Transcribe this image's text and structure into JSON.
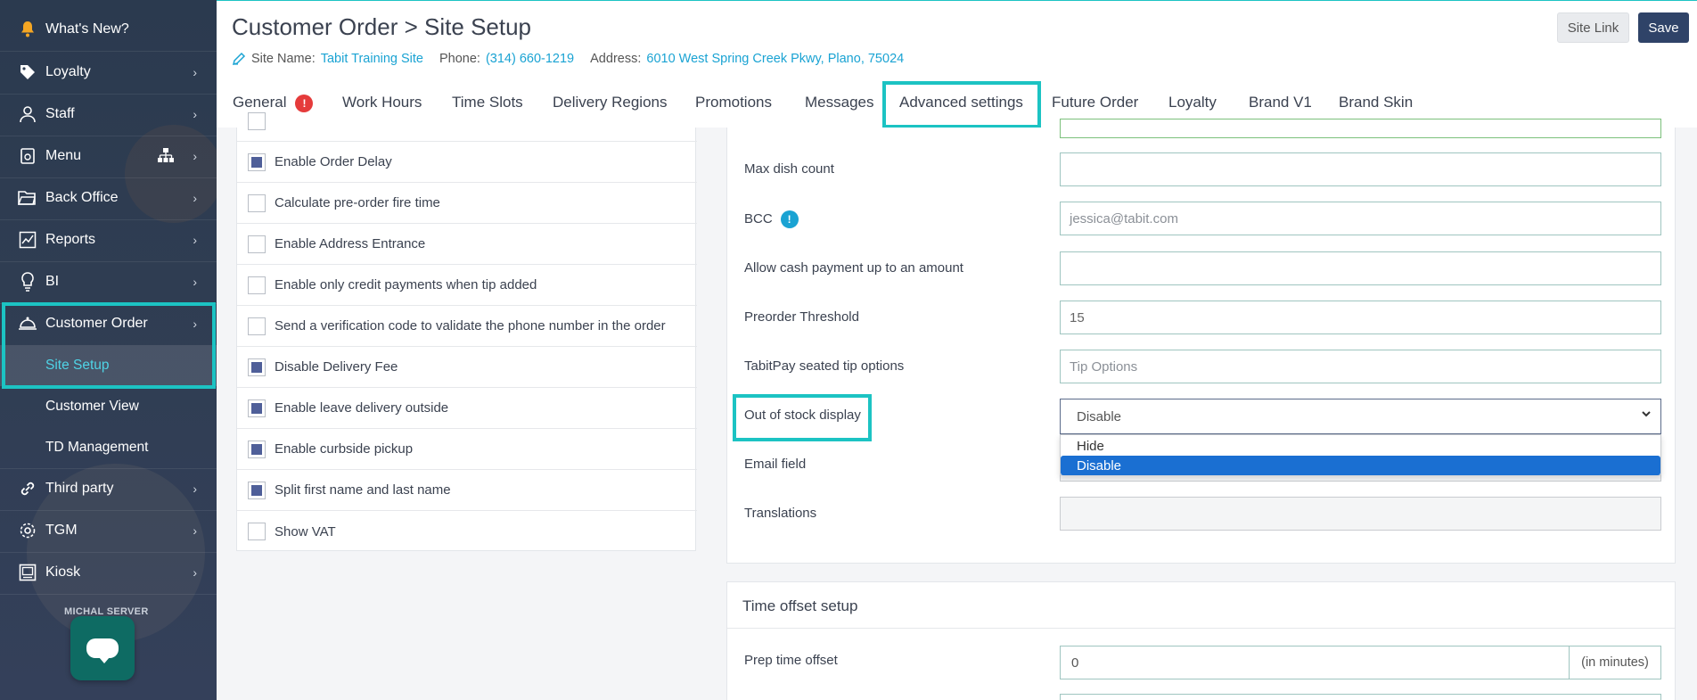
{
  "sidebar": {
    "items": [
      {
        "label": "What's New?"
      },
      {
        "label": "Loyalty"
      },
      {
        "label": "Staff"
      },
      {
        "label": "Menu"
      },
      {
        "label": "Back Office"
      },
      {
        "label": "Reports"
      },
      {
        "label": "BI"
      },
      {
        "label": "Customer Order"
      },
      {
        "label": "Third party"
      },
      {
        "label": "TGM"
      },
      {
        "label": "Kiosk"
      }
    ],
    "sub_items": [
      {
        "label": "Site Setup",
        "active": true
      },
      {
        "label": "Customer View"
      },
      {
        "label": "TD Management"
      }
    ],
    "server_label": "MICHAL SERVER",
    "accent_color": "#1cc3c3"
  },
  "header": {
    "breadcrumb_parent": "Customer Order",
    "breadcrumb_sep": ">",
    "title": "Site Setup",
    "site_name_label": "Site Name:",
    "site_name": "Tabit Training Site",
    "phone_label": "Phone:",
    "phone": "(314) 660-1219",
    "address_label": "Address:",
    "address": "6010 West Spring Creek Pkwy, Plano, 75024",
    "site_link_label": "Site Link",
    "save_label": "Save",
    "tabs": [
      {
        "label": "General",
        "badge": "!"
      },
      {
        "label": "Work Hours"
      },
      {
        "label": "Time Slots"
      },
      {
        "label": "Delivery Regions"
      },
      {
        "label": "Promotions"
      },
      {
        "label": "Messages"
      },
      {
        "label": "Advanced settings",
        "active": true
      },
      {
        "label": "Future Order"
      },
      {
        "label": "Loyalty"
      },
      {
        "label": "Brand V1"
      },
      {
        "label": "Brand Skin"
      }
    ]
  },
  "checkboxes": [
    {
      "label": "Enable Order Delay",
      "checked": true
    },
    {
      "label": "Calculate pre-order fire time",
      "checked": false
    },
    {
      "label": "Enable Address Entrance",
      "checked": false
    },
    {
      "label": "Enable only credit payments when tip added",
      "checked": false
    },
    {
      "label": "Send a verification code to validate the phone number in the order",
      "checked": false
    },
    {
      "label": "Disable Delivery Fee",
      "checked": true
    },
    {
      "label": "Enable leave delivery outside",
      "checked": true
    },
    {
      "label": "Enable curbside pickup",
      "checked": true
    },
    {
      "label": "Split first name and last name",
      "checked": true
    },
    {
      "label": "Show VAT",
      "checked": false
    }
  ],
  "fields": {
    "max_dish_count": {
      "label": "Max dish count",
      "value": ""
    },
    "bcc": {
      "label": "BCC",
      "info": "!",
      "placeholder": "jessica@tabit.com"
    },
    "cash_payment": {
      "label": "Allow cash payment up to an amount",
      "value": ""
    },
    "preorder_threshold": {
      "label": "Preorder Threshold",
      "value": "15"
    },
    "tip_options": {
      "label": "TabitPay seated tip options",
      "placeholder": "Tip Options"
    },
    "out_of_stock": {
      "label": "Out of stock display",
      "value": "Disable",
      "options": [
        "Hide",
        "Disable"
      ]
    },
    "email_field": {
      "label": "Email field"
    },
    "translations": {
      "label": "Translations"
    }
  },
  "time_offset": {
    "title": "Time offset setup",
    "prep_label": "Prep time offset",
    "prep_value": "0",
    "prep_unit": "(in minutes)"
  }
}
